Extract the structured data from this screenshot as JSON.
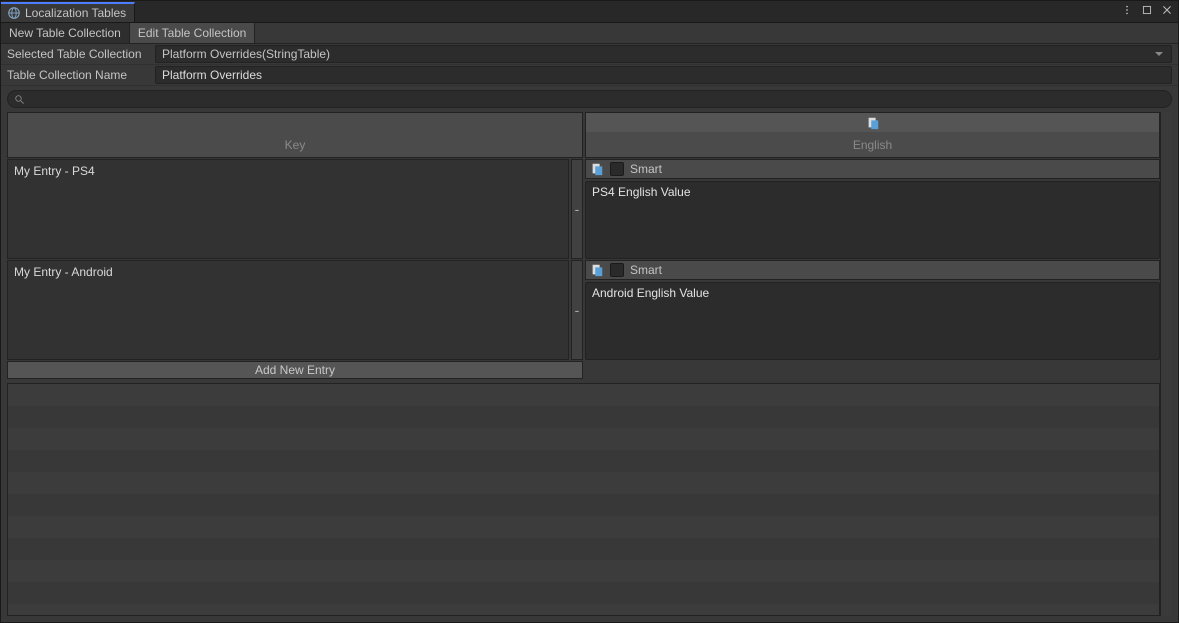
{
  "window": {
    "title": "Localization Tables"
  },
  "tabs": {
    "new_label": "New Table Collection",
    "edit_label": "Edit Table Collection"
  },
  "fields": {
    "selected_label": "Selected Table Collection",
    "selected_value": "Platform Overrides(StringTable)",
    "name_label": "Table Collection Name",
    "name_value": "Platform Overrides"
  },
  "search": {
    "placeholder": ""
  },
  "columns": {
    "key_header": "Key",
    "locale_header": "English"
  },
  "entries": [
    {
      "key": "My Entry - PS4",
      "smart_label": "Smart",
      "smart_checked": false,
      "value": "PS4 English Value"
    },
    {
      "key": "My Entry - Android",
      "smart_label": "Smart",
      "smart_checked": false,
      "value": "Android English Value"
    }
  ],
  "buttons": {
    "add_entry": "Add New Entry",
    "remove": "-"
  }
}
